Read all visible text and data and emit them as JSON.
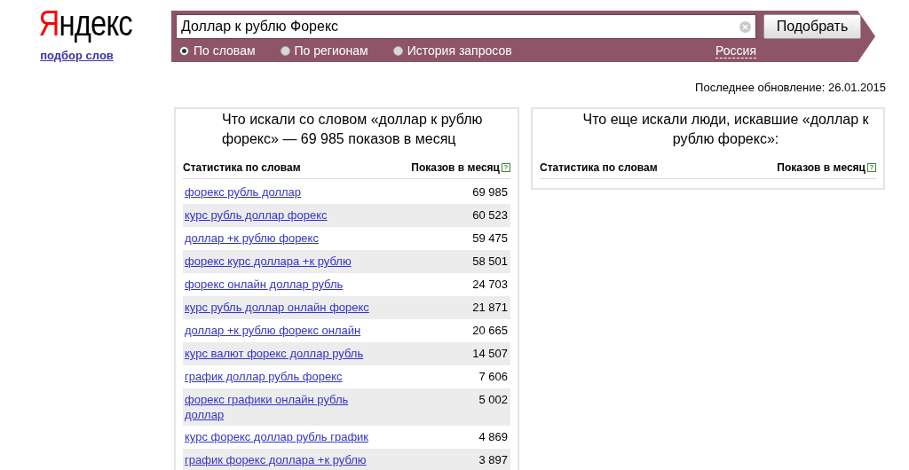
{
  "logo": {
    "first_letter": "Я",
    "rest": "ндекс",
    "subtitle": "подбор слов"
  },
  "search": {
    "value": "Доллар к рублю Форекс",
    "button": "Подобрать",
    "region": "Россия",
    "modes": [
      {
        "label": "По словам",
        "selected": true
      },
      {
        "label": "По регионам",
        "selected": false
      },
      {
        "label": "История запросов",
        "selected": false
      }
    ]
  },
  "last_update": "Последнее обновление: 26.01.2015",
  "left_panel": {
    "title": "Что искали со словом «доллар к рублю форекс» — 69 985 показов в месяц",
    "columns": [
      "Статистика по словам",
      "Показов в месяц"
    ],
    "help": "?",
    "rows": [
      {
        "phrase": "форекс рубль доллар",
        "count": "69 985"
      },
      {
        "phrase": "курс рубль доллар форекс",
        "count": "60 523"
      },
      {
        "phrase": "доллар +к рублю форекс",
        "count": "59 475"
      },
      {
        "phrase": "форекс курс доллара +к рублю",
        "count": "58 501"
      },
      {
        "phrase": "форекс онлайн доллар рубль",
        "count": "24 703"
      },
      {
        "phrase": "курс рубль доллар онлайн форекс",
        "count": "21 871"
      },
      {
        "phrase": "доллар +к рублю форекс онлайн",
        "count": "20 665"
      },
      {
        "phrase": "курс валют форекс доллар рубль",
        "count": "14 507"
      },
      {
        "phrase": "график доллар рубль форекс",
        "count": "7 606"
      },
      {
        "phrase": "форекс графики онлайн рубль доллар",
        "count": "5 002"
      },
      {
        "phrase": "курс форекс доллар рубль график",
        "count": "4 869"
      },
      {
        "phrase": "график форекс доллара +к рублю",
        "count": "3 897"
      }
    ]
  },
  "right_panel": {
    "title": "Что еще искали люди, искавшие «доллар к рублю форекс»:",
    "columns": [
      "Статистика по словам",
      "Показов в месяц"
    ],
    "help": "?"
  }
}
